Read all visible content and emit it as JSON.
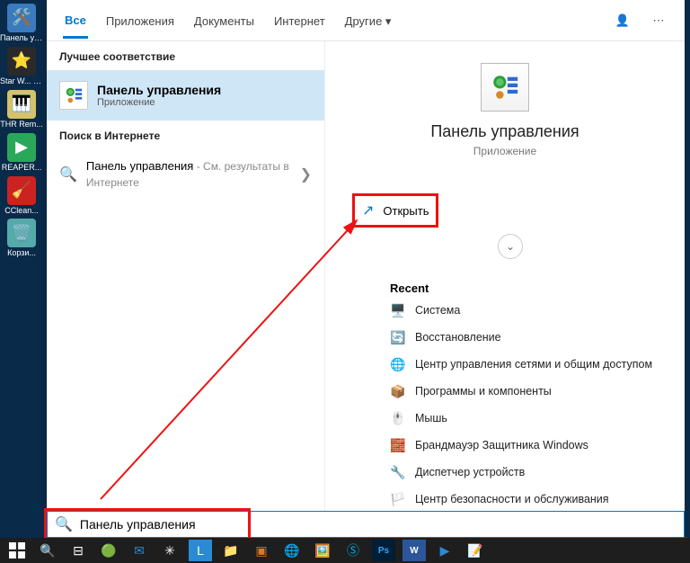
{
  "desktop_icons": [
    {
      "label": "Панель управле...",
      "bg": "#3a7abd"
    },
    {
      "label": "Star W... Jedi Fa",
      "bg": "#2a2a2a"
    },
    {
      "label": "THR Rem...",
      "bg": "#d6c26a"
    },
    {
      "label": "REAPER...",
      "bg": "#2aa85a"
    },
    {
      "label": "CClean...",
      "bg": "#c22"
    },
    {
      "label": "Корзи...",
      "bg": "#5aa"
    }
  ],
  "tabs": {
    "all": "Все",
    "apps": "Приложения",
    "docs": "Документы",
    "web": "Интернет",
    "more": "Другие"
  },
  "left": {
    "best_match_header": "Лучшее соответствие",
    "best_title": "Панель управления",
    "best_sub": "Приложение",
    "web_header": "Поиск в Интернете",
    "web_title": "Панель управления",
    "web_sub": " - См. результаты в Интернете"
  },
  "right": {
    "title": "Панель управления",
    "sub": "Приложение",
    "open": "Открыть",
    "recent_header": "Recent",
    "recent": [
      "Система",
      "Восстановление",
      "Центр управления сетями и общим доступом",
      "Программы и компоненты",
      "Мышь",
      "Брандмауэр Защитника Windows",
      "Диспетчер устройств",
      "Центр безопасности и обслуживания"
    ]
  },
  "search": {
    "value": "Панель управления"
  },
  "annotation_color": "#e11"
}
